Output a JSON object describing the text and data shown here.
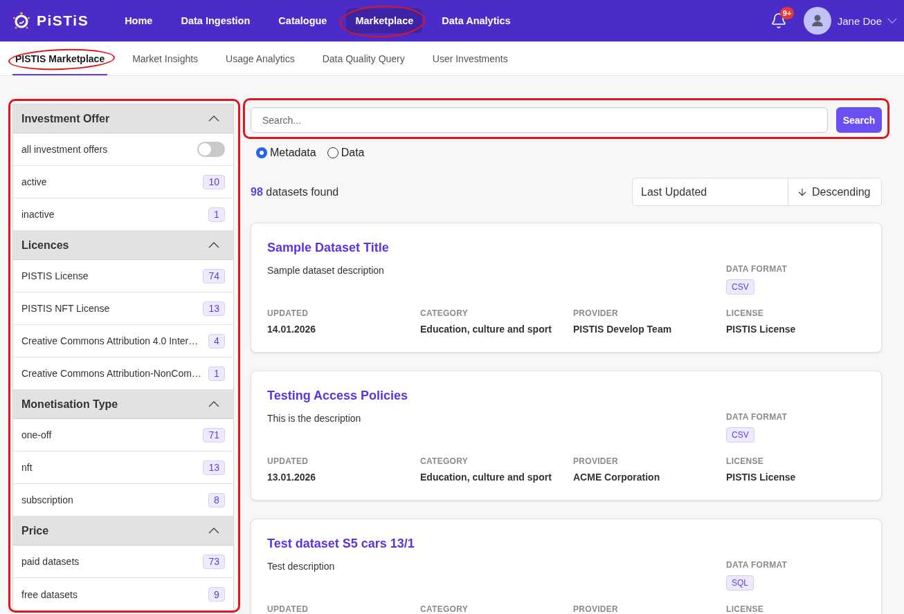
{
  "header": {
    "logo": "PiSTiS",
    "nav": [
      {
        "label": "Home",
        "selected": false,
        "highlighted": false
      },
      {
        "label": "Data Ingestion",
        "selected": false,
        "highlighted": false
      },
      {
        "label": "Catalogue",
        "selected": false,
        "highlighted": false
      },
      {
        "label": "Marketplace",
        "selected": true,
        "highlighted": true
      },
      {
        "label": "Data Analytics",
        "selected": false,
        "highlighted": false
      }
    ],
    "notifications": {
      "badge": "9+"
    },
    "user": {
      "name": "Jane Doe"
    }
  },
  "tabs": [
    {
      "label": "PISTIS Marketplace",
      "selected": true,
      "highlighted": true
    },
    {
      "label": "Market Insights",
      "selected": false,
      "highlighted": false
    },
    {
      "label": "Usage Analytics",
      "selected": false,
      "highlighted": false
    },
    {
      "label": "Data Quality Query",
      "selected": false,
      "highlighted": false
    },
    {
      "label": "User Investments",
      "selected": false,
      "highlighted": false
    }
  ],
  "filters": {
    "highlighted": true,
    "sections": [
      {
        "title": "Investment Offer",
        "expanded": true,
        "items": [
          {
            "kind": "toggle",
            "label": "all investment offers",
            "on": false
          },
          {
            "kind": "count",
            "label": "active",
            "count": "10"
          },
          {
            "kind": "count",
            "label": "inactive",
            "count": "1"
          }
        ]
      },
      {
        "title": "Licences",
        "expanded": true,
        "items": [
          {
            "kind": "count",
            "label": "PISTIS License",
            "count": "74"
          },
          {
            "kind": "count",
            "label": "PISTIS NFT License",
            "count": "13"
          },
          {
            "kind": "count",
            "label": "Creative Commons Attribution 4.0 Inter…",
            "count": "4"
          },
          {
            "kind": "count",
            "label": "Creative Commons Attribution-NonCom…",
            "count": "1"
          }
        ]
      },
      {
        "title": "Monetisation Type",
        "expanded": true,
        "items": [
          {
            "kind": "count",
            "label": "one-off",
            "count": "71"
          },
          {
            "kind": "count",
            "label": "nft",
            "count": "13"
          },
          {
            "kind": "count",
            "label": "subscription",
            "count": "8"
          }
        ]
      },
      {
        "title": "Price",
        "expanded": true,
        "items": [
          {
            "kind": "count",
            "label": "paid datasets",
            "count": "73"
          },
          {
            "kind": "count",
            "label": "free datasets",
            "count": "9"
          }
        ]
      }
    ]
  },
  "search": {
    "placeholder": "Search...",
    "button": "Search",
    "highlighted": true,
    "modes": [
      {
        "label": "Metadata",
        "selected": true
      },
      {
        "label": "Data",
        "selected": false
      }
    ]
  },
  "results": {
    "summary": "**98** datasets found",
    "sort": {
      "field": "Last Updated",
      "order": "Descending"
    }
  },
  "datasets": [
    {
      "title": "Sample Dataset Title",
      "description": "Sample dataset description",
      "format_label": "DATA FORMAT",
      "format": "CSV",
      "fields": [
        {
          "label": "UPDATED",
          "value": "14.01.2026"
        },
        {
          "label": "CATEGORY",
          "value": "Education, culture and sport"
        },
        {
          "label": "PROVIDER",
          "value": "PISTIS Develop Team"
        },
        {
          "label": "LICENSE",
          "value": "PISTIS License"
        }
      ]
    },
    {
      "title": "Testing Access Policies",
      "description": "This is the description",
      "format_label": "DATA FORMAT",
      "format": "CSV",
      "fields": [
        {
          "label": "UPDATED",
          "value": "13.01.2026"
        },
        {
          "label": "CATEGORY",
          "value": "Education, culture and sport"
        },
        {
          "label": "PROVIDER",
          "value": "ACME Corporation"
        },
        {
          "label": "LICENSE",
          "value": "PISTIS License"
        }
      ]
    },
    {
      "title": "Test dataset S5 cars 13/1",
      "description": "Test description",
      "format_label": "DATA FORMAT",
      "format": "SQL",
      "fields": [
        {
          "label": "UPDATED"
        },
        {
          "label": "CATEGORY"
        },
        {
          "label": "PROVIDER"
        },
        {
          "label": "LICENSE"
        }
      ]
    }
  ]
}
